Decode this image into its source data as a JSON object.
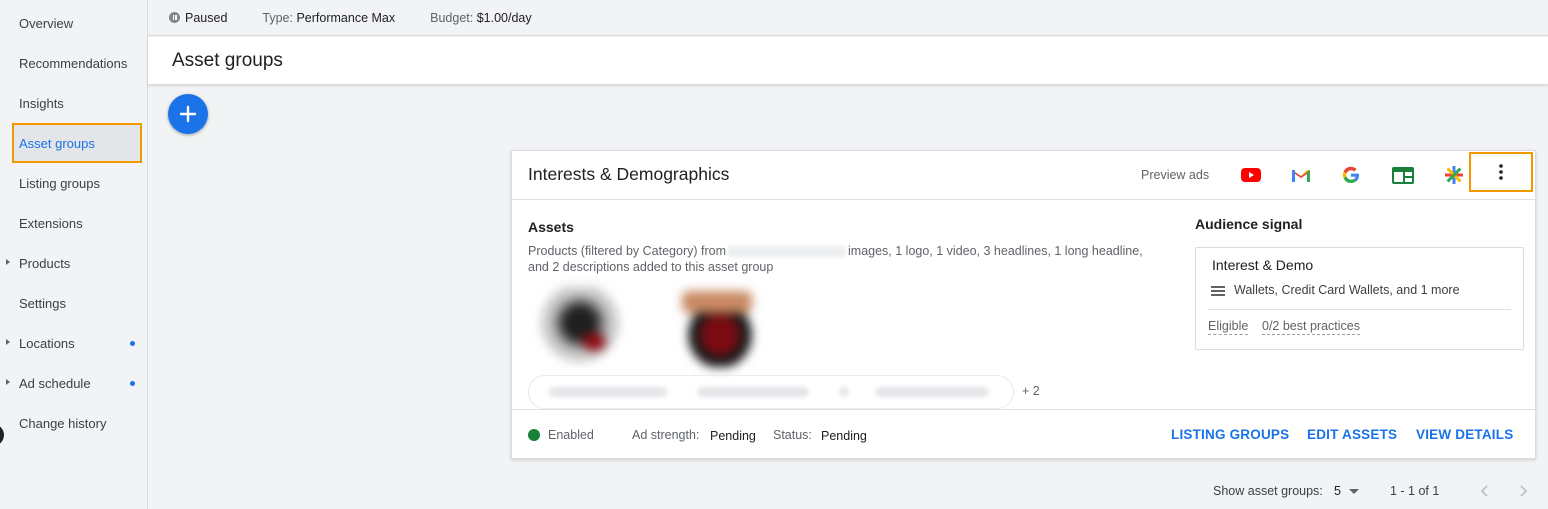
{
  "sidebar": {
    "items": [
      {
        "label": "Overview"
      },
      {
        "label": "Recommendations"
      },
      {
        "label": "Insights"
      },
      {
        "label": "Asset groups",
        "active": true
      },
      {
        "label": "Listing groups"
      },
      {
        "label": "Extensions"
      },
      {
        "label": "Products",
        "expandable": true
      },
      {
        "label": "Settings"
      },
      {
        "label": "Locations",
        "expandable": true,
        "dot": true
      },
      {
        "label": "Ad schedule",
        "expandable": true,
        "dot": true
      },
      {
        "label": "Change history"
      }
    ]
  },
  "status_bar": {
    "status": "Paused",
    "type_label": "Type:",
    "type_value": "Performance Max",
    "budget_label": "Budget:",
    "budget_value": "$1.00/day"
  },
  "page": {
    "title": "Asset groups"
  },
  "asset_group": {
    "title": "Interests & Demographics",
    "preview_label": "Preview ads",
    "preview_icons": [
      "youtube-icon",
      "gmail-icon",
      "google-search-icon",
      "display-icon",
      "discover-icon"
    ],
    "assets_label": "Assets",
    "assets_desc_prefix": "Products (filtered by Category) from",
    "assets_desc_suffix": "images, 1 logo, 1 video, 3 headlines, 1 long headline, and 2 descriptions added to this asset group",
    "chips_more": "+ 2",
    "audience_label": "Audience signal",
    "audience_name": "Interest & Demo",
    "audience_desc": "Wallets, Credit Card Wallets, and 1 more",
    "audience_status": "Eligible",
    "audience_best_practices": "0/2 best practices",
    "status": "Enabled",
    "status_color": "#188038",
    "ad_strength_label": "Ad strength:",
    "ad_strength_value": "Pending",
    "status_label": "Status:",
    "status_value": "Pending",
    "actions": {
      "listing_groups": "LISTING GROUPS",
      "edit_assets": "EDIT ASSETS",
      "view_details": "VIEW DETAILS"
    }
  },
  "pagination": {
    "show_label": "Show asset groups:",
    "page_size": "5",
    "range": "1 - 1 of 1"
  },
  "colors": {
    "accent": "#1a73e8",
    "highlight": "#f29900"
  }
}
